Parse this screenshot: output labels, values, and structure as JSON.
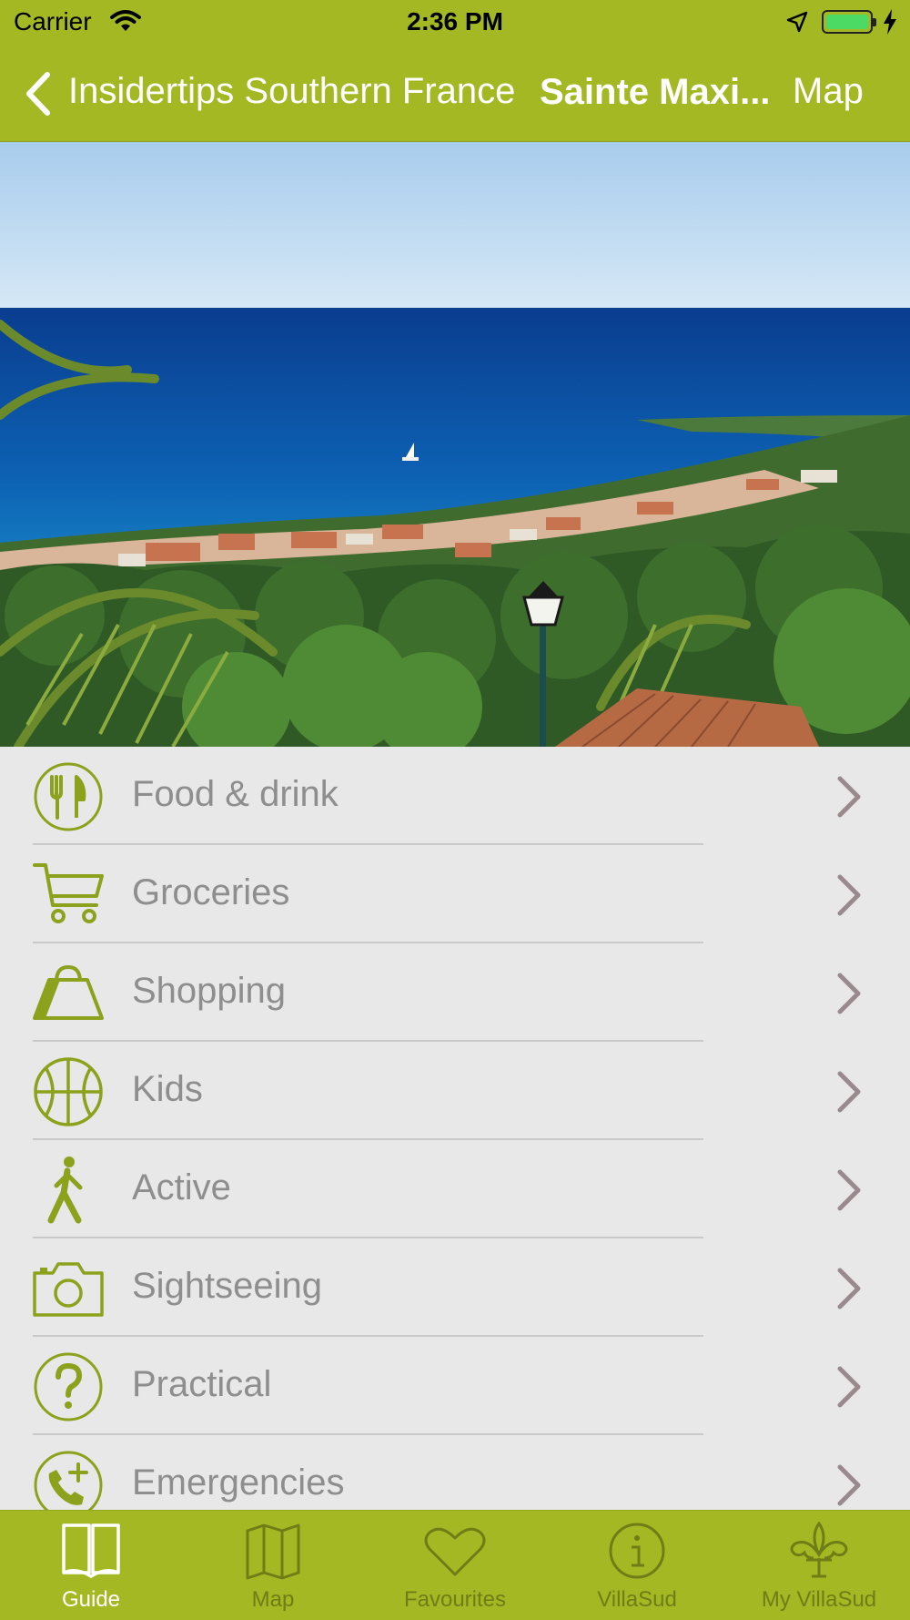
{
  "status_bar": {
    "carrier": "Carrier",
    "time": "2:36 PM"
  },
  "nav": {
    "back_label": "Insidertips Southern France",
    "title": "Sainte Maxi...",
    "map_button": "Map"
  },
  "menu": {
    "items": [
      {
        "label": "Food & drink",
        "icon": "fork-knife-icon"
      },
      {
        "label": "Groceries",
        "icon": "shopping-cart-icon"
      },
      {
        "label": "Shopping",
        "icon": "shopping-bag-icon"
      },
      {
        "label": "Kids",
        "icon": "basketball-icon"
      },
      {
        "label": "Active",
        "icon": "walking-person-icon"
      },
      {
        "label": "Sightseeing",
        "icon": "camera-icon"
      },
      {
        "label": "Practical",
        "icon": "question-icon"
      },
      {
        "label": "Emergencies",
        "icon": "phone-plus-icon"
      }
    ]
  },
  "tabs": [
    {
      "label": "Guide",
      "icon": "book-icon",
      "active": true
    },
    {
      "label": "Map",
      "icon": "map-icon",
      "active": false
    },
    {
      "label": "Favourites",
      "icon": "heart-icon",
      "active": false
    },
    {
      "label": "VillaSud",
      "icon": "info-icon",
      "active": false
    },
    {
      "label": "My VillaSud",
      "icon": "fleur-de-lis-icon",
      "active": false
    }
  ],
  "colors": {
    "accent": "#a4b823",
    "icon_green": "#8ca21c",
    "chevron": "#9a8a8e",
    "label_gray": "#8e8e8e"
  }
}
